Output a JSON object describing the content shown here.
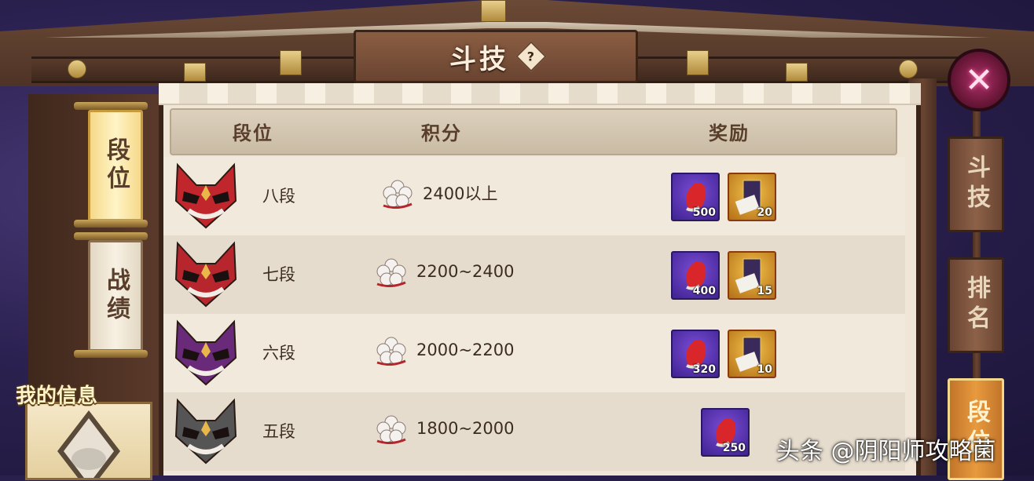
{
  "title": "斗技",
  "help_label": "?",
  "close_label": "✕",
  "left_tabs": [
    {
      "label": "段位",
      "active": true
    },
    {
      "label": "战绩",
      "active": false
    }
  ],
  "my_info_label": "我的信息",
  "right_tabs": [
    {
      "label": "斗技",
      "active": false
    },
    {
      "label": "排名",
      "active": false
    },
    {
      "label": "段位",
      "active": true
    }
  ],
  "table": {
    "headers": {
      "rank": "段位",
      "score": "积分",
      "reward": "奖励"
    },
    "rows": [
      {
        "rank": "八段",
        "score": "2400以上",
        "mask_color": "#c0262b",
        "rewards": [
          {
            "type": "purple",
            "count": "500"
          },
          {
            "type": "gold",
            "count": "20"
          }
        ]
      },
      {
        "rank": "七段",
        "score": "2200~2400",
        "mask_color": "#b8262d",
        "rewards": [
          {
            "type": "purple",
            "count": "400"
          },
          {
            "type": "gold",
            "count": "15"
          }
        ]
      },
      {
        "rank": "六段",
        "score": "2000~2200",
        "mask_color": "#6a2a7a",
        "rewards": [
          {
            "type": "purple",
            "count": "320"
          },
          {
            "type": "gold",
            "count": "10"
          }
        ]
      },
      {
        "rank": "五段",
        "score": "1800~2000",
        "mask_color": "#555555",
        "rewards": [
          {
            "type": "purple",
            "count": "250"
          }
        ]
      }
    ]
  },
  "watermark": "头条 @阴阳师攻略菌"
}
